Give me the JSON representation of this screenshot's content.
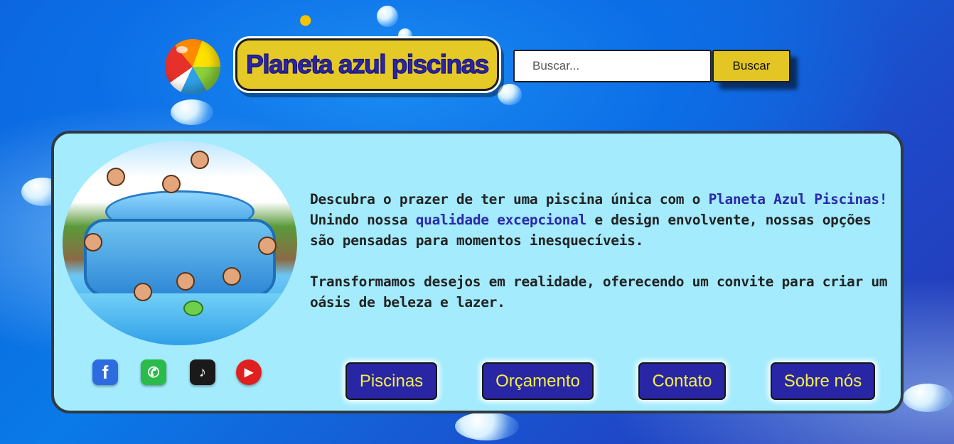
{
  "header": {
    "logo_text": "Planeta azul piscinas",
    "search_placeholder": "Buscar...",
    "search_button": "Buscar"
  },
  "main": {
    "description": {
      "p1_part1": "Descubra o prazer de ter uma piscina única com o ",
      "p1_highlight1": "Planeta Azul Piscinas!",
      "p1_part2": " Unindo nossa ",
      "p1_highlight2": "qualidade excepcional",
      "p1_part3": " e design envolvente, nossas opções são pensadas para momentos inesquecíveis.",
      "p2": "Transformamos desejos em realidade, oferecendo um convite para criar um oásis de beleza e lazer."
    },
    "social": [
      {
        "name": "facebook",
        "glyph": "f"
      },
      {
        "name": "whatsapp",
        "glyph": "✆"
      },
      {
        "name": "tiktok",
        "glyph": "♪"
      },
      {
        "name": "youtube",
        "glyph": "▶"
      }
    ],
    "nav": [
      {
        "label": "Piscinas"
      },
      {
        "label": "Orçamento"
      },
      {
        "label": "Contato"
      },
      {
        "label": "Sobre nós"
      }
    ]
  },
  "colors": {
    "accent_yellow": "#e3c623",
    "nav_blue": "#2926a6",
    "nav_text": "#f2ef4a",
    "card_bg": "#a3ebfd",
    "highlight_text": "#2a2aa8"
  }
}
